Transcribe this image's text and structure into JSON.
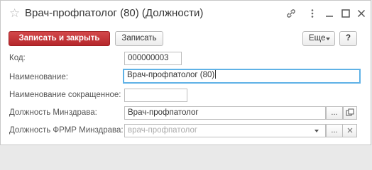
{
  "window": {
    "title": "Врач-профпатолог (80) (Должности)",
    "icons": [
      "star-icon",
      "link-icon",
      "more-icon",
      "minimize-icon",
      "maximize-icon",
      "close-icon"
    ]
  },
  "toolbar": {
    "save_close_label": "Записать и закрыть",
    "save_label": "Записать",
    "more_label": "Еще",
    "help_label": "?"
  },
  "form": {
    "code": {
      "label": "Код:",
      "value": "000000003"
    },
    "name": {
      "label": "Наименование:",
      "value": "Врач-профпатолог (80)"
    },
    "short_name": {
      "label": "Наименование сокращенное:",
      "value": ""
    },
    "minzdrav_position": {
      "label": "Должность Минздрава:",
      "value": "Врач-профпатолог"
    },
    "frmr_position": {
      "label": "Должность ФРМР Минздрава:",
      "placeholder": "врач-профпатолог"
    }
  },
  "colors": {
    "primary_button": "#c0373a",
    "focus_border": "#5fb2e6"
  }
}
